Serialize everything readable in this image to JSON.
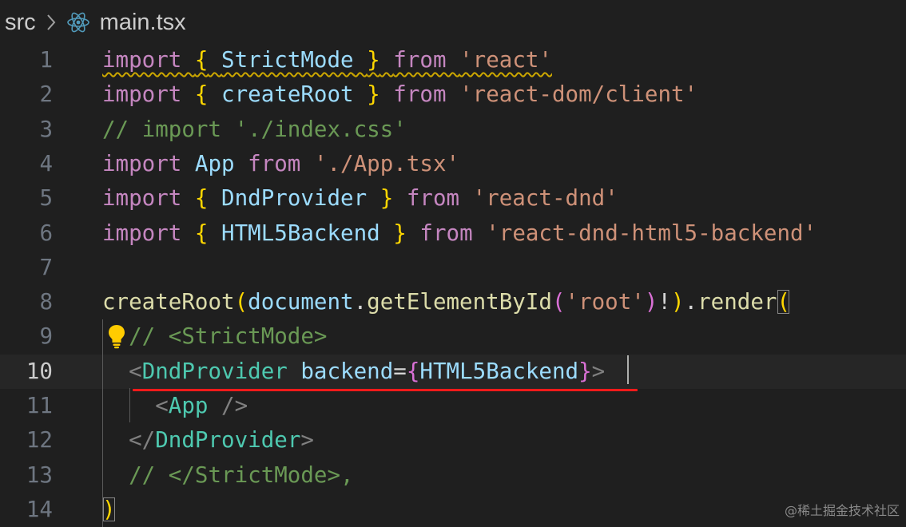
{
  "breadcrumb": {
    "folder": "src",
    "separator_icon": "chevron-right-icon",
    "file_icon": "react-icon",
    "file": "main.tsx"
  },
  "lines": [
    {
      "n": "1",
      "parts": [
        [
          "kw",
          "import"
        ],
        [
          "txt",
          " "
        ],
        [
          "br1",
          "{"
        ],
        [
          "txt",
          " "
        ],
        [
          "var",
          "StrictMode"
        ],
        [
          "txt",
          " "
        ],
        [
          "br1",
          "}"
        ],
        [
          "txt",
          " "
        ],
        [
          "kw",
          "from"
        ],
        [
          "txt",
          " "
        ],
        [
          "str",
          "'react'"
        ]
      ]
    },
    {
      "n": "2",
      "parts": [
        [
          "kw",
          "import"
        ],
        [
          "txt",
          " "
        ],
        [
          "br1",
          "{"
        ],
        [
          "txt",
          " "
        ],
        [
          "var",
          "createRoot"
        ],
        [
          "txt",
          " "
        ],
        [
          "br1",
          "}"
        ],
        [
          "txt",
          " "
        ],
        [
          "kw",
          "from"
        ],
        [
          "txt",
          " "
        ],
        [
          "str",
          "'react-dom/client'"
        ]
      ]
    },
    {
      "n": "3",
      "parts": [
        [
          "cm",
          "// import './index.css'"
        ]
      ]
    },
    {
      "n": "4",
      "parts": [
        [
          "kw",
          "import"
        ],
        [
          "txt",
          " "
        ],
        [
          "var",
          "App"
        ],
        [
          "txt",
          " "
        ],
        [
          "kw",
          "from"
        ],
        [
          "txt",
          " "
        ],
        [
          "str",
          "'./App.tsx'"
        ]
      ]
    },
    {
      "n": "5",
      "parts": [
        [
          "kw",
          "import"
        ],
        [
          "txt",
          " "
        ],
        [
          "br1",
          "{"
        ],
        [
          "txt",
          " "
        ],
        [
          "var",
          "DndProvider"
        ],
        [
          "txt",
          " "
        ],
        [
          "br1",
          "}"
        ],
        [
          "txt",
          " "
        ],
        [
          "kw",
          "from"
        ],
        [
          "txt",
          " "
        ],
        [
          "str",
          "'react-dnd'"
        ]
      ]
    },
    {
      "n": "6",
      "parts": [
        [
          "kw",
          "import"
        ],
        [
          "txt",
          " "
        ],
        [
          "br1",
          "{"
        ],
        [
          "txt",
          " "
        ],
        [
          "var",
          "HTML5Backend"
        ],
        [
          "txt",
          " "
        ],
        [
          "br1",
          "}"
        ],
        [
          "txt",
          " "
        ],
        [
          "kw",
          "from"
        ],
        [
          "txt",
          " "
        ],
        [
          "str",
          "'react-dnd-html5-backend'"
        ]
      ]
    },
    {
      "n": "7",
      "parts": []
    },
    {
      "n": "8",
      "parts": [
        [
          "fn",
          "createRoot"
        ],
        [
          "br1",
          "("
        ],
        [
          "var",
          "document"
        ],
        [
          "txt",
          "."
        ],
        [
          "fn",
          "getElementById"
        ],
        [
          "br2",
          "("
        ],
        [
          "str",
          "'root'"
        ],
        [
          "br2",
          ")"
        ],
        [
          "txt",
          "!"
        ],
        [
          "br1",
          ")"
        ],
        [
          "txt",
          "."
        ],
        [
          "fn",
          "render"
        ],
        [
          "br1",
          "("
        ]
      ]
    },
    {
      "n": "9",
      "parts": [
        [
          "txt",
          "  "
        ],
        [
          "cm",
          "// <StrictMode>"
        ]
      ]
    },
    {
      "n": "10",
      "parts": [
        [
          "txt",
          "  "
        ],
        [
          "punc",
          "<"
        ],
        [
          "tag",
          "DndProvider"
        ],
        [
          "txt",
          " "
        ],
        [
          "var",
          "backend"
        ],
        [
          "txt",
          "="
        ],
        [
          "br2",
          "{"
        ],
        [
          "var",
          "HTML5Backend"
        ],
        [
          "br2",
          "}"
        ],
        [
          "punc",
          ">"
        ]
      ]
    },
    {
      "n": "11",
      "parts": [
        [
          "txt",
          "    "
        ],
        [
          "punc",
          "<"
        ],
        [
          "tag",
          "App"
        ],
        [
          "txt",
          " "
        ],
        [
          "punc",
          "/>"
        ]
      ]
    },
    {
      "n": "12",
      "parts": [
        [
          "txt",
          "  "
        ],
        [
          "punc",
          "</"
        ],
        [
          "tag",
          "DndProvider"
        ],
        [
          "punc",
          ">"
        ]
      ]
    },
    {
      "n": "13",
      "parts": [
        [
          "txt",
          "  "
        ],
        [
          "cm",
          "// </StrictMode>,"
        ]
      ]
    },
    {
      "n": "14",
      "parts": [
        [
          "br1",
          ")"
        ]
      ]
    }
  ],
  "current_line": "10",
  "lightbulb_icon": "lightbulb-icon",
  "watermark": "@稀土掘金技术社区"
}
